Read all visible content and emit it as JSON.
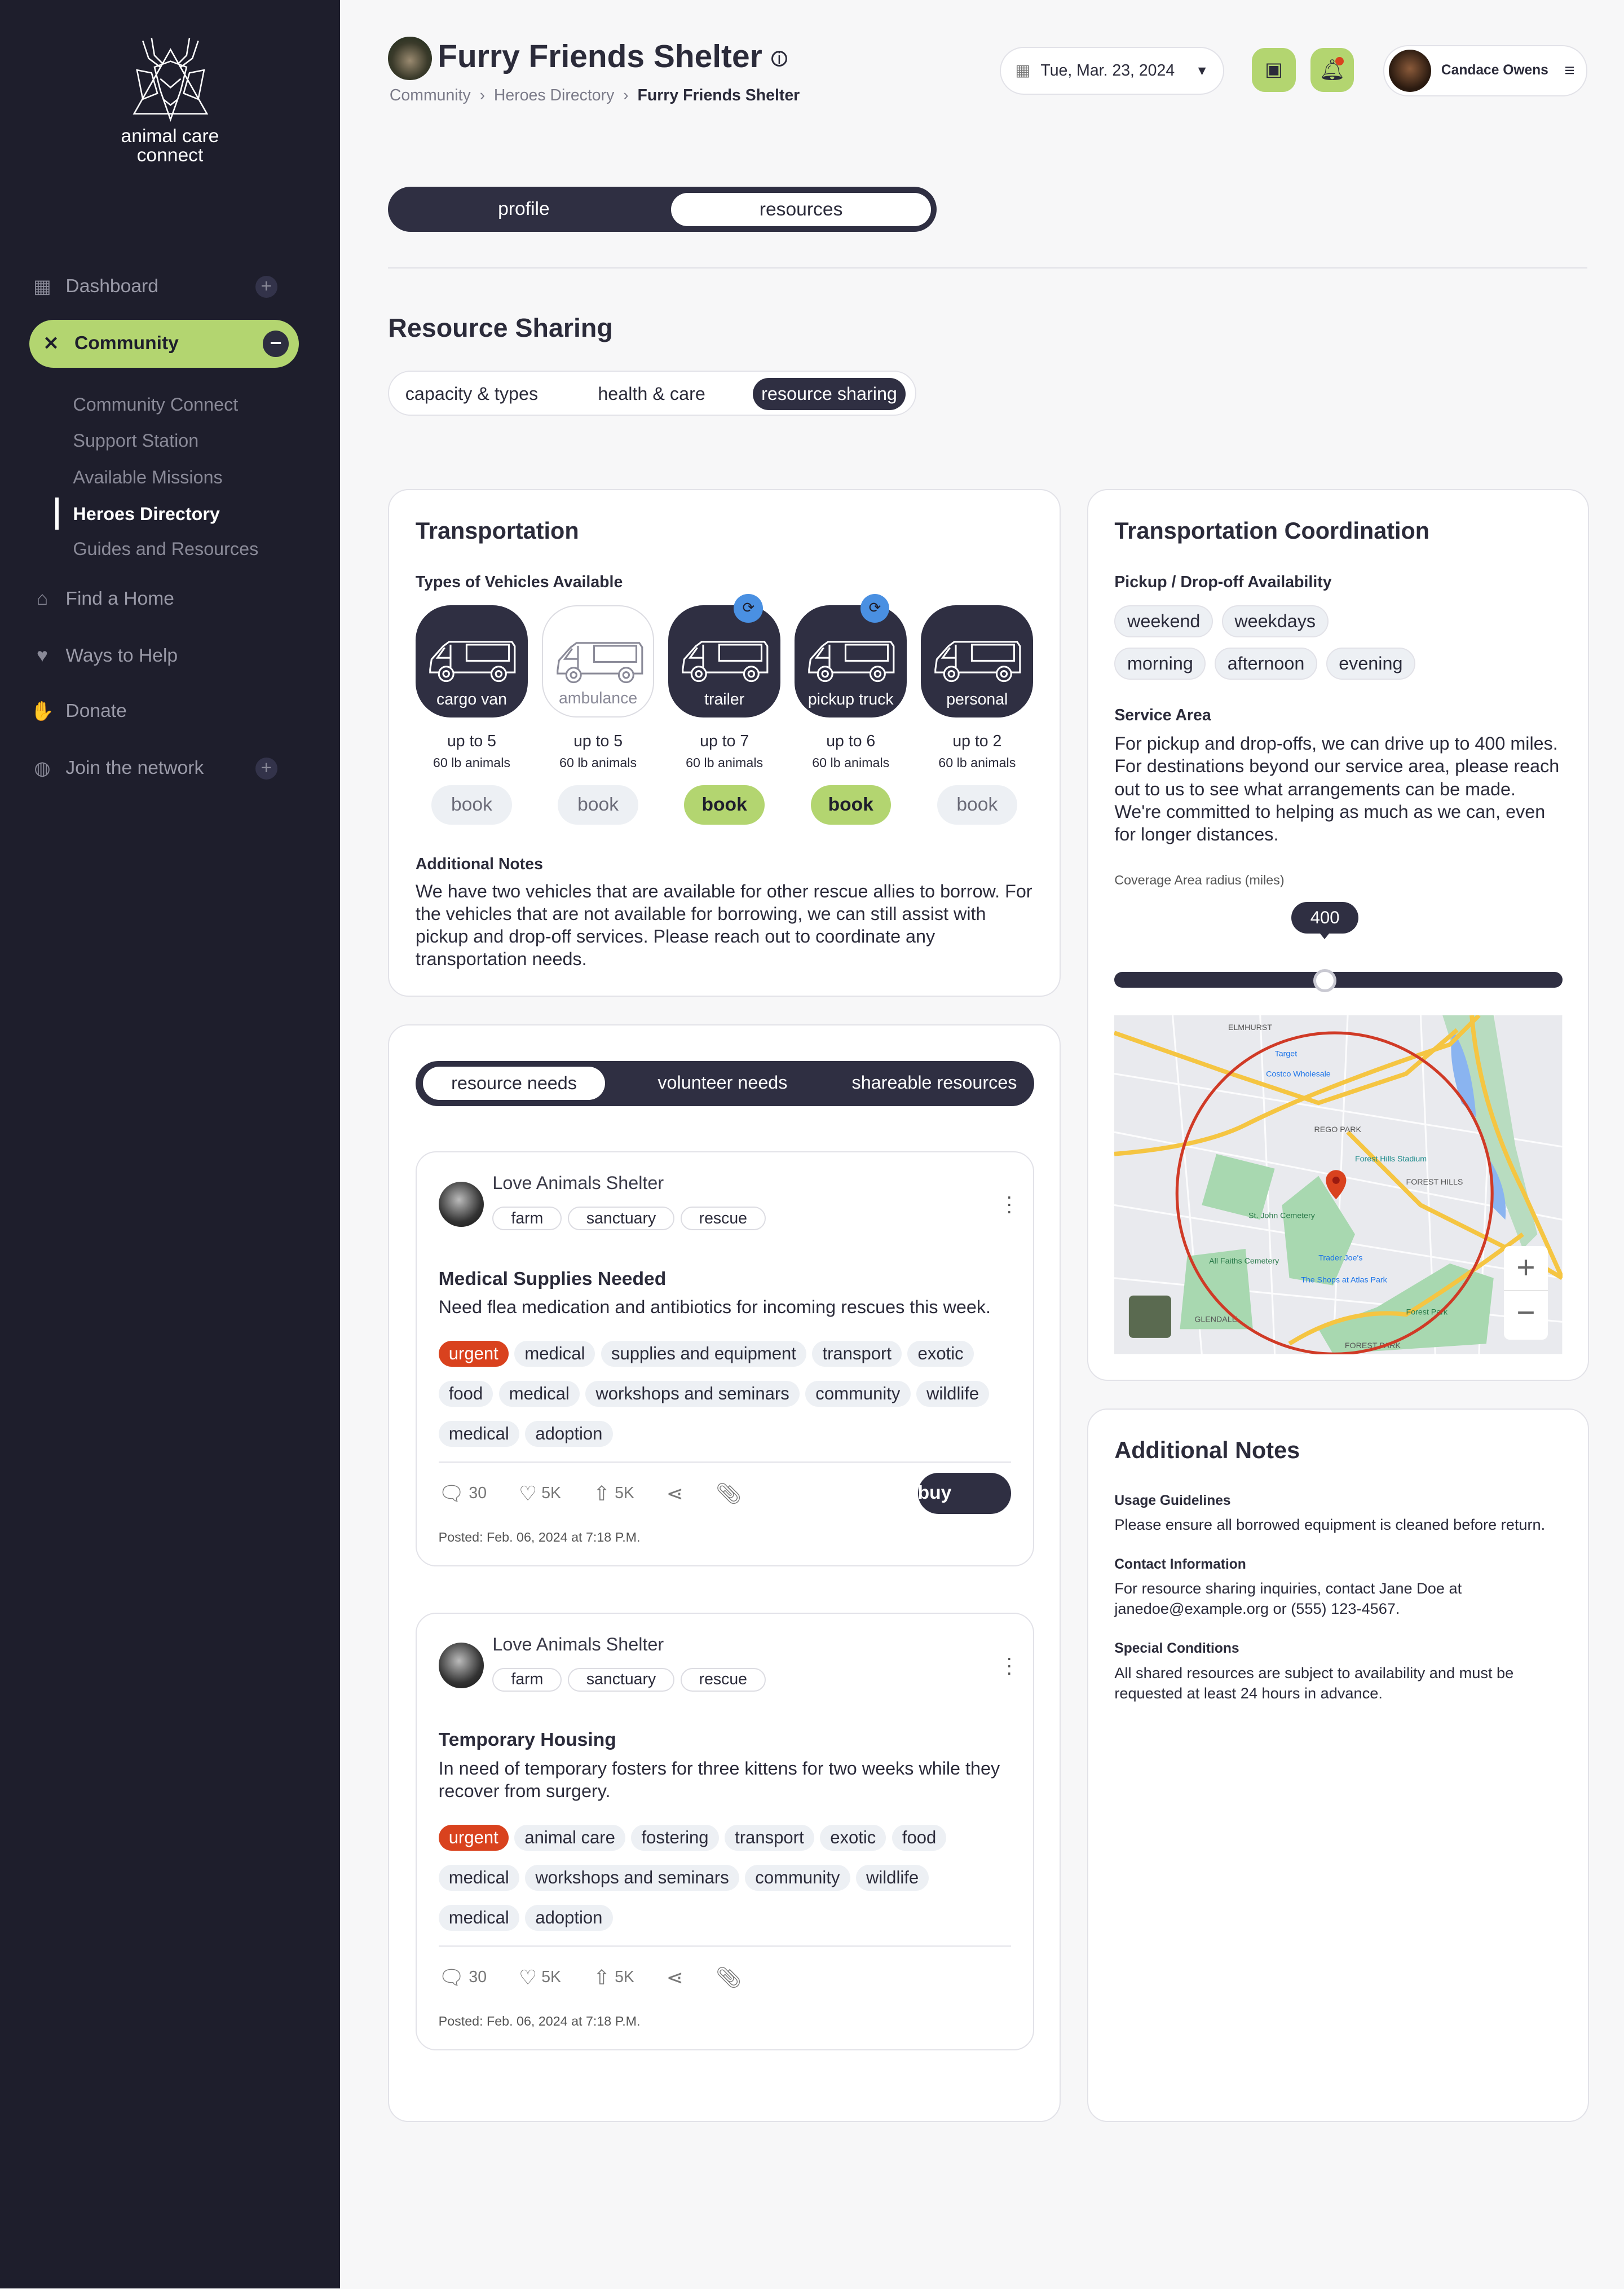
{
  "brand": {
    "name_line1": "animal care",
    "name_line2": "connect"
  },
  "sidebar": {
    "dashboard": "Dashboard",
    "community": "Community",
    "community_sub": [
      "Community Connect",
      "Support Station",
      "Available Missions",
      "Heroes Directory",
      "Guides and Resources"
    ],
    "find_home": "Find a Home",
    "ways_help": "Ways to Help",
    "donate": "Donate",
    "join": "Join the network"
  },
  "header": {
    "title": "Furry Friends Shelter",
    "breadcrumb": [
      "Community",
      "Heroes Directory",
      "Furry Friends Shelter"
    ],
    "date": "Tue, Mar. 23, 2024",
    "user": "Candace Owens"
  },
  "main_tabs": {
    "profile": "profile",
    "resources": "resources",
    "active": "resources"
  },
  "section_title": "Resource Sharing",
  "sub_tabs": {
    "items": [
      "capacity & types",
      "health & care",
      "resource sharing"
    ],
    "active": "resource sharing"
  },
  "transportation": {
    "title": "Transportation",
    "vehicles_label": "Types of Vehicles Available",
    "vehicles": [
      {
        "name": "cargo van",
        "capacity": "up to 5",
        "size": "60 lb animals",
        "book": "book",
        "available": true,
        "booked": false,
        "badge": false
      },
      {
        "name": "ambulance",
        "capacity": "up to 5",
        "size": "60 lb animals",
        "book": "book",
        "available": false,
        "booked": false,
        "badge": false
      },
      {
        "name": "trailer",
        "capacity": "up to 7",
        "size": "60 lb animals",
        "book": "book",
        "available": true,
        "booked": true,
        "badge": true
      },
      {
        "name": "pickup truck",
        "capacity": "up to 6",
        "size": "60 lb animals",
        "book": "book",
        "available": true,
        "booked": true,
        "badge": true
      },
      {
        "name": "personal",
        "capacity": "up to 2",
        "size": "60 lb animals",
        "book": "book",
        "available": true,
        "booked": false,
        "badge": false
      }
    ],
    "notes_label": "Additional Notes",
    "notes": "We have two vehicles that are available for other rescue allies to borrow. For the vehicles that are not available for borrowing, we can still assist with pickup and drop-off services. Please reach out to coordinate any transportation needs."
  },
  "coordination": {
    "title": "Transportation Coordination",
    "availability_label": "Pickup / Drop-off Availability",
    "availability_row1": [
      "weekend",
      "weekdays"
    ],
    "availability_row2": [
      "morning",
      "afternoon",
      "evening"
    ],
    "service_label": "Service Area",
    "service_text": "For pickup and drop-offs, we can drive up to 400 miles. For destinations beyond our service area, please reach out to us to see what arrangements can be made. We're committed to helping as much as we can, even for longer distances.",
    "radius_label": "Coverage Area radius (miles)",
    "radius_value": "400",
    "radius_fraction": 0.47,
    "map_labels": [
      "ELMHURST",
      "REGO PARK",
      "FOREST HILLS",
      "GLENDALE",
      "FOREST PARK",
      "Forest Hills Stadium",
      "St. John Cemetery",
      "All Faiths Cemetery",
      "Trader Joe's",
      "The Shops at Atlas Park",
      "Forest Park",
      "Target",
      "Costco Wholesale"
    ]
  },
  "needs": {
    "tabs": [
      "resource needs",
      "volunteer needs",
      "shareable resources"
    ],
    "active": "resource needs",
    "posts": [
      {
        "org": "Love Animals Shelter",
        "org_tags": [
          "farm",
          "sanctuary",
          "rescue"
        ],
        "title": "Medical Supplies Needed",
        "desc": "Need flea medication and antibiotics for incoming rescues this week.",
        "tags": [
          "urgent",
          "medical",
          "supplies and equipment",
          "transport",
          "exotic",
          "food",
          "medical",
          "workshops and seminars",
          "community",
          "wildlife",
          "medical",
          "adoption"
        ],
        "comments": "30",
        "likes": "5K",
        "upvotes": "5K",
        "action": "buy",
        "posted": "Posted: Feb. 06, 2024 at 7:18 P.M."
      },
      {
        "org": "Love Animals Shelter",
        "org_tags": [
          "farm",
          "sanctuary",
          "rescue"
        ],
        "title": "Temporary Housing",
        "desc": "In need of temporary fosters for three kittens for two weeks while they recover from surgery.",
        "tags": [
          "urgent",
          "animal care",
          "fostering",
          "transport",
          "exotic",
          "food",
          "medical",
          "workshops and seminars",
          "community",
          "wildlife",
          "medical",
          "adoption"
        ],
        "comments": "30",
        "likes": "5K",
        "upvotes": "5K",
        "posted": "Posted: Feb. 06, 2024 at 7:18 P.M."
      }
    ]
  },
  "additional_notes": {
    "title": "Additional Notes",
    "items": [
      {
        "label": "Usage Guidelines",
        "text": "Please ensure all borrowed equipment is cleaned before return."
      },
      {
        "label": "Contact Information",
        "text": "For resource sharing inquiries, contact Jane Doe at janedoe@example.org or (555) 123-4567."
      },
      {
        "label": "Special Conditions",
        "text": "All shared resources are subject to availability and must be requested at least 24 hours in advance."
      }
    ]
  },
  "colors": {
    "sidebar": "#1e1e2c",
    "accent_green": "#b3d570",
    "dark": "#2f2f42",
    "urgent": "#d9421e",
    "badge_blue": "#4a90e2",
    "radius_circle": "#d03a26"
  }
}
